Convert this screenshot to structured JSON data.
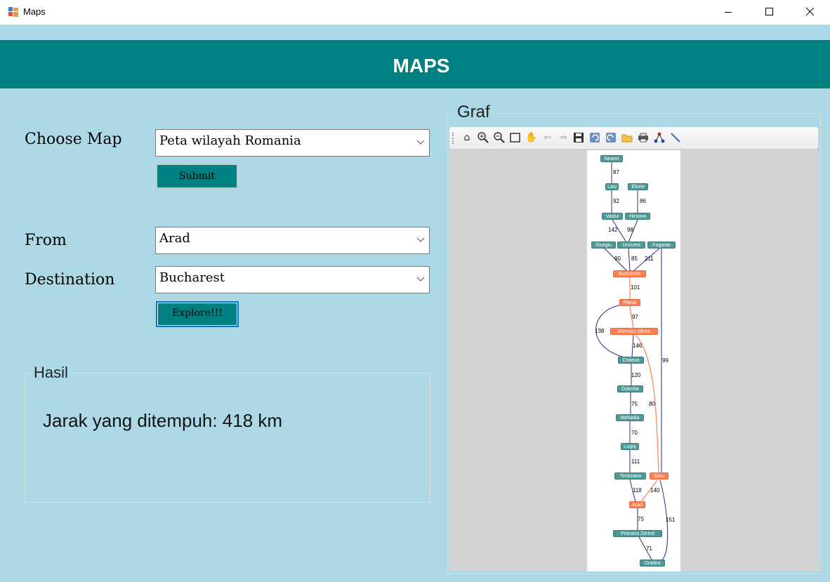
{
  "window": {
    "title": "Maps"
  },
  "header": {
    "title": "MAPS"
  },
  "form": {
    "choose_map_label": "Choose Map",
    "choose_map_value": "Peta wilayah Romania",
    "submit_label": "Submit",
    "from_label": "From",
    "from_value": "Arad",
    "destination_label": "Destination",
    "destination_value": "Bucharest",
    "explore_label": "Explore!!!"
  },
  "result": {
    "group_title": "Hasil",
    "text": "Jarak yang ditempuh: 418 km"
  },
  "graph": {
    "group_title": "Graf",
    "toolbar": [
      "home-icon",
      "zoom-in-icon",
      "zoom-out-icon",
      "zoom-window-icon",
      "pan-hand-icon",
      "back-arrow-icon",
      "forward-arrow-icon",
      "save-icon",
      "undo-icon",
      "redo-icon",
      "open-folder-icon",
      "print-icon",
      "layout-icon",
      "edge-tool-icon"
    ],
    "nodes": [
      {
        "id": "neamt",
        "label": "Neamt",
        "color": "teal"
      },
      {
        "id": "lasi",
        "label": "Lasi",
        "color": "teal"
      },
      {
        "id": "eforie",
        "label": "Eforie",
        "color": "teal"
      },
      {
        "id": "vaslui",
        "label": "Vaslui",
        "color": "teal"
      },
      {
        "id": "hirsova",
        "label": "Hirsova",
        "color": "teal"
      },
      {
        "id": "giurgiu",
        "label": "Giurgiu",
        "color": "teal"
      },
      {
        "id": "urziceni",
        "label": "Urziceni",
        "color": "teal"
      },
      {
        "id": "fagaras",
        "label": "Fagaras",
        "color": "teal"
      },
      {
        "id": "bucharest",
        "label": "Bucharest",
        "color": "orange"
      },
      {
        "id": "pitesti",
        "label": "Pitesti",
        "color": "orange"
      },
      {
        "id": "rimnicu",
        "label": "Rimnicu Vilcea",
        "color": "orange"
      },
      {
        "id": "craiova",
        "label": "Craiova",
        "color": "teal"
      },
      {
        "id": "dobreta",
        "label": "Dobreta",
        "color": "teal"
      },
      {
        "id": "mehadia",
        "label": "Mehadia",
        "color": "teal"
      },
      {
        "id": "lugoj",
        "label": "Lugoj",
        "color": "teal"
      },
      {
        "id": "timisoara",
        "label": "Timisoara",
        "color": "teal"
      },
      {
        "id": "sibiu",
        "label": "Sibiu",
        "color": "orange"
      },
      {
        "id": "arad",
        "label": "Arad",
        "color": "orange"
      },
      {
        "id": "zerind",
        "label": "Primaria Zerind",
        "color": "teal"
      },
      {
        "id": "oradea",
        "label": "Oradea",
        "color": "teal"
      }
    ],
    "edge_labels": [
      "87",
      "92",
      "86",
      "142",
      "98",
      "90",
      "85",
      "211",
      "101",
      "97",
      "138",
      "146",
      "99",
      "120",
      "75",
      "80",
      "70",
      "111",
      "118",
      "140",
      "75",
      "151",
      "71"
    ],
    "colors": {
      "path": "#ff7f50",
      "edge": "#2b2b8c",
      "node": "#4f9996",
      "header": "#008080",
      "background": "#ADD8E6"
    }
  }
}
